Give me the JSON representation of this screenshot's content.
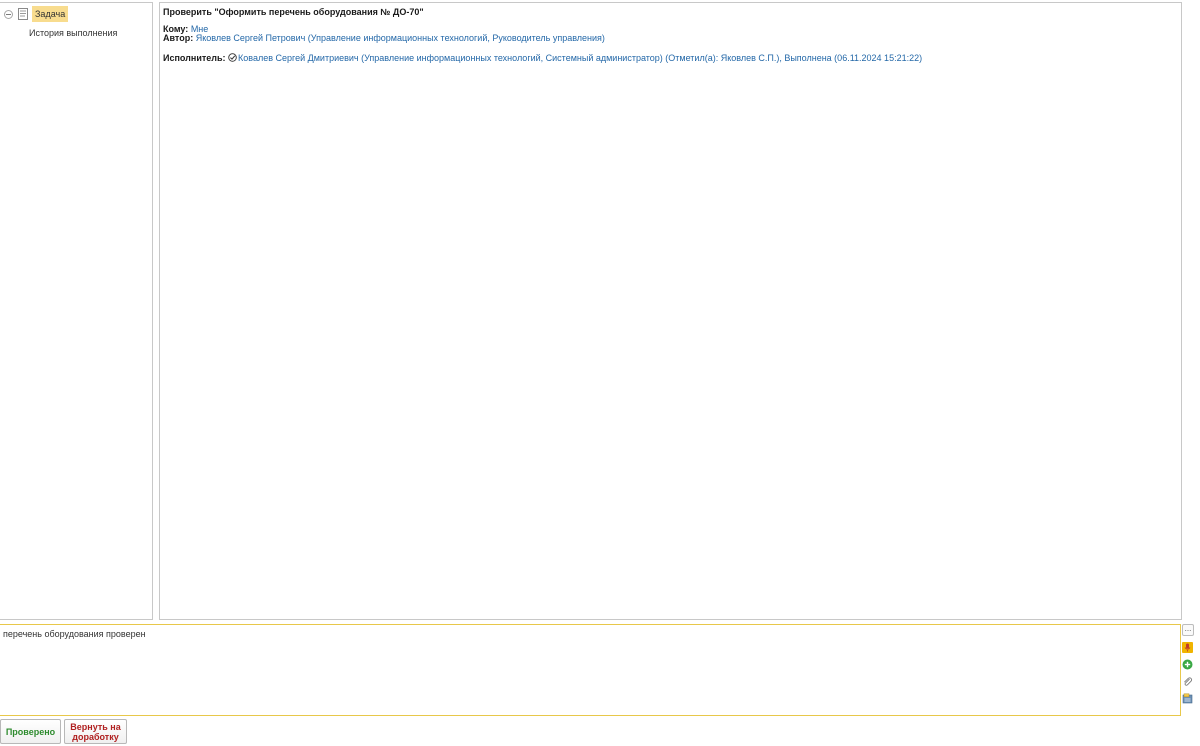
{
  "tree": {
    "root_label": "Задача",
    "child_label": "История выполнения"
  },
  "task": {
    "title": "Проверить \"Оформить перечень оборудования № ДО-70\"",
    "to_label": "Кому:",
    "to_value": "Мне",
    "author_label": "Автор:",
    "author_value": "Яковлев Сергей Петрович (Управление информационных технологий, Руководитель управления)",
    "executor_label": "Исполнитель:",
    "executor_value": "Ковалев Сергей Дмитриевич (Управление информационных технологий, Системный администратор) (Отметил(а): Яковлев С.П.), Выполнена (06.11.2024 15:21:22)"
  },
  "comment": {
    "text": "перечень оборудования проверен",
    "dots_label": "..."
  },
  "side_tools": {
    "icons": [
      "microphone-icon",
      "add-icon",
      "paperclip-icon",
      "template-icon"
    ]
  },
  "buttons": {
    "approve_label": "Проверено",
    "return_label": "Вернуть на доработку"
  },
  "colors": {
    "link": "#2468a8",
    "selected": "#f8dc8e",
    "approve": "#2e8b2e",
    "return": "#b02020",
    "focus_border": "#e8c84a"
  }
}
